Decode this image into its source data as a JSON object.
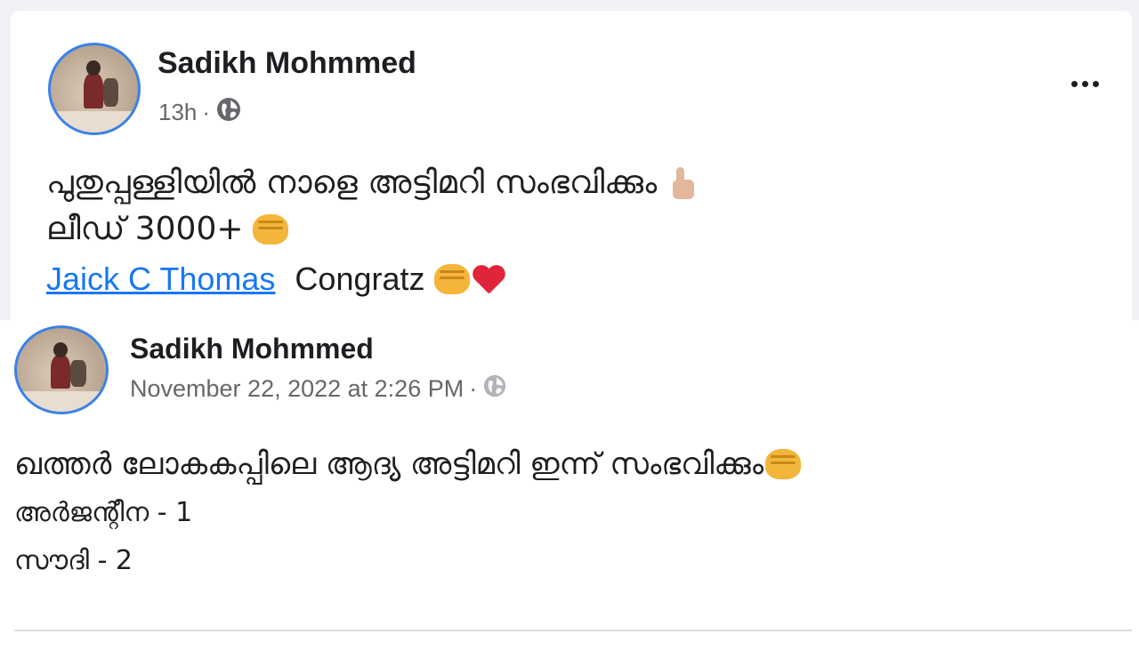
{
  "post1": {
    "author": "Sadikh Mohmmed",
    "time": "13h",
    "separator": "·",
    "privacy_icon": "globe-icon",
    "more_icon": "more-options-icon",
    "line1_text": "പുതുപ്പള്ളിയിൽ നാളെ അട്ടിമറി സംഭവിക്കും",
    "line1_emoji": "thumbs-up-emoji",
    "line2_text": "ലീഡ് 3000+",
    "line2_emoji": "raised-fist-emoji",
    "mention_name": "Jaick C Thomas",
    "comment_text": "Congratz",
    "comment_emojis": [
      "raised-fist-emoji",
      "red-heart-emoji"
    ]
  },
  "post2": {
    "author": "Sadikh Mohmmed",
    "timestamp": "November 22, 2022 at 2:26 PM",
    "separator": "·",
    "privacy_icon": "globe-icon",
    "line1_text": "ഖത്തർ ലോകകപ്പിലെ ആദ്യ അട്ടിമറി ഇന്ന് സംഭവിക്കും",
    "line1_emoji": "raised-fist-emoji",
    "score_lines": [
      "അർജന്റീന - 1",
      "സൗദി - 2"
    ]
  },
  "colors": {
    "avatar_ring": "#3b82e6",
    "link": "#1877f2",
    "meta_text": "#65676b",
    "fist": "#f4b63a",
    "heart": "#e0243a"
  }
}
